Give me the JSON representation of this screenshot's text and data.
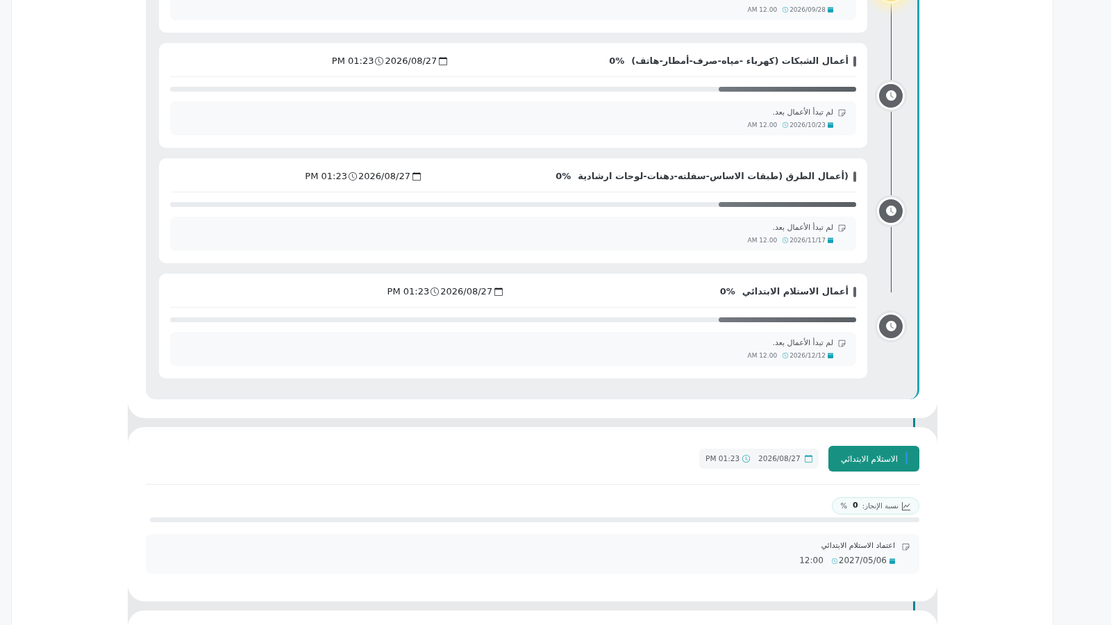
{
  "timeline": {
    "tasks": [
      {
        "kind": "in_progress",
        "note": {
          "date": "2026/09/28",
          "time": "AM 12.00"
        }
      },
      {
        "kind": "pending",
        "title": "أعمال الشبكات (كهرباء -مياه-صرف-أمطار-هاتف)",
        "percent": "0%",
        "date": "2026/08/27",
        "time": "PM 01:23",
        "level": 0.2,
        "note": {
          "text": "لم تبدأ الأعمال بعد.",
          "date": "2026/10/23",
          "time": "AM 12.00"
        }
      },
      {
        "kind": "pending",
        "title": "(أعمال الطرق (طبقات الاساس-سفلته-دهنات-لوحات ارشادية",
        "percent": "0%",
        "date": "2026/08/27",
        "time": "PM 01:23",
        "level": 0.2,
        "note": {
          "text": "لم تبدأ الأعمال بعد.",
          "date": "2026/11/17",
          "time": "AM 12.00"
        }
      },
      {
        "kind": "pending",
        "title": "أعمال الاستلام الابتدائي",
        "percent": "0%",
        "date": "2026/08/27",
        "time": "PM 01:23",
        "level": 0.2,
        "note": {
          "text": "لم تبدأ الأعمال بعد.",
          "date": "2026/12/12",
          "time": "AM 12.00"
        }
      }
    ]
  },
  "stage": {
    "button": "الاستلام الابتدائي",
    "date": "2026/08/27",
    "time": "PM 01:23",
    "progress": {
      "label": "نسبة الإنجاز:",
      "value": "0",
      "unit": "%"
    },
    "note": {
      "text": "اعتماد الاستلام الابتدائي",
      "date": "2027/05/06",
      "time": "12:00"
    }
  }
}
